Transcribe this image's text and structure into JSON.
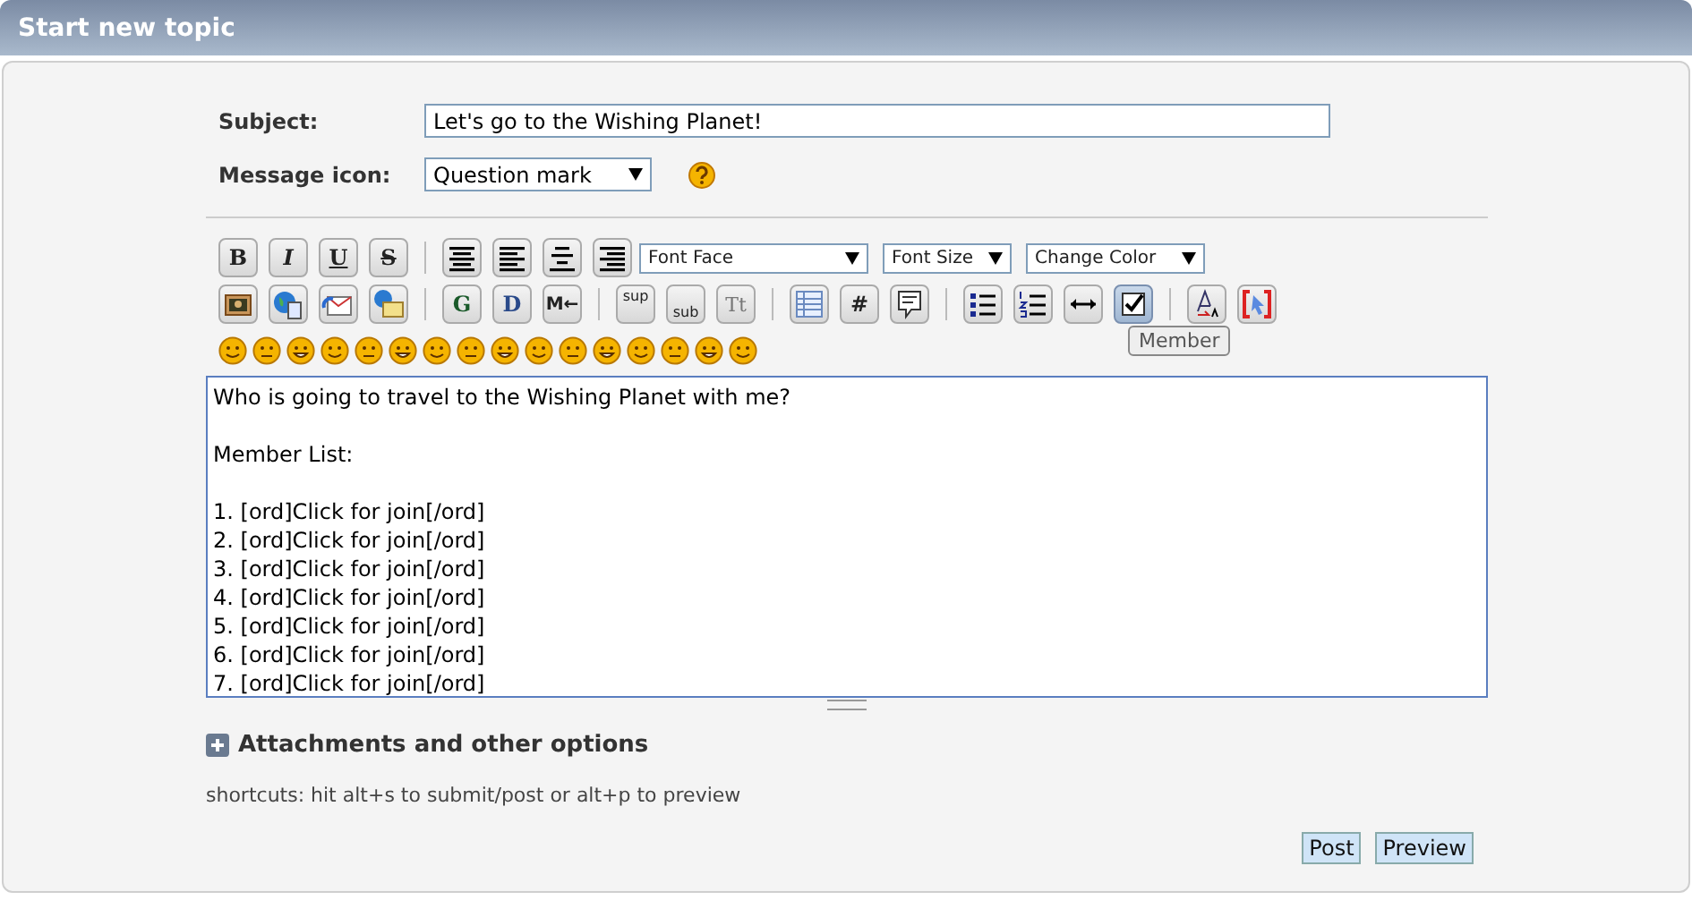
{
  "header": {
    "title": "Start new topic"
  },
  "subject": {
    "label": "Subject:",
    "value": "Let's go to the Wishing Planet!"
  },
  "message_icon": {
    "label": "Message icon:",
    "value": "Question mark"
  },
  "toolbar": {
    "rows": [
      [
        [
          {
            "kind": "text",
            "label": "B",
            "highlighted": false
          },
          {
            "kind": "text",
            "label": "I",
            "highlighted": false
          },
          {
            "kind": "text",
            "label": "U",
            "highlighted": false
          },
          {
            "kind": "text",
            "label": "S",
            "highlighted": false
          }
        ],
        [
          {
            "kind": "icon",
            "highlighted": false
          },
          {
            "kind": "icon",
            "highlighted": false
          },
          {
            "kind": "icon",
            "highlighted": false
          },
          {
            "kind": "icon",
            "highlighted": false
          }
        ]
      ],
      [
        [
          {
            "kind": "icon",
            "highlighted": false
          },
          {
            "kind": "icon",
            "highlighted": false
          },
          {
            "kind": "icon",
            "highlighted": false
          },
          {
            "kind": "icon",
            "highlighted": false
          }
        ],
        [
          {
            "kind": "text",
            "label": "G",
            "highlighted": false
          },
          {
            "kind": "text",
            "label": "D",
            "highlighted": false
          },
          {
            "kind": "text",
            "label": "M←",
            "highlighted": false
          }
        ],
        [
          {
            "kind": "text",
            "label": "sup",
            "highlighted": false
          },
          {
            "kind": "text",
            "label": "sub",
            "highlighted": false
          },
          {
            "kind": "text",
            "label": "Tt",
            "highlighted": false
          }
        ],
        [
          {
            "kind": "icon",
            "highlighted": false
          },
          {
            "kind": "text",
            "label": "#",
            "highlighted": false
          },
          {
            "kind": "icon",
            "highlighted": false
          }
        ],
        [
          {
            "kind": "icon",
            "highlighted": false
          },
          {
            "kind": "icon",
            "highlighted": false
          },
          {
            "kind": "icon",
            "highlighted": false
          },
          {
            "kind": "icon",
            "highlighted": true
          }
        ],
        [
          {
            "kind": "icon",
            "highlighted": false
          },
          {
            "kind": "icon",
            "highlighted": false
          }
        ]
      ]
    ],
    "selects": [
      "Font Face",
      "Font Size",
      "Change Color"
    ],
    "tooltip": "Member"
  },
  "message": {
    "paragraphs": [
      [
        "Who is going to travel to the Wishing Planet with me?"
      ],
      [
        "Member List:"
      ],
      [
        "1. [ord]Click for join[/ord]",
        "2. [ord]Click for join[/ord]",
        "3. [ord]Click for join[/ord]",
        "4. [ord]Click for join[/ord]",
        "5. [ord]Click for join[/ord]",
        "6. [ord]Click for join[/ord]",
        "7. [ord]Click for join[/ord]"
      ]
    ]
  },
  "attachments": {
    "label": "Attachments and other options",
    "expanded": false
  },
  "shortcuts": "shortcuts: hit alt+s to submit/post or alt+p to preview",
  "buttons": [
    "Post",
    "Preview"
  ]
}
